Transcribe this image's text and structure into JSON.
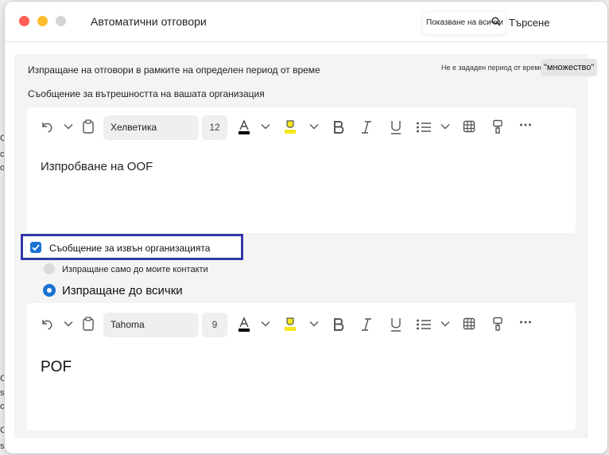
{
  "window": {
    "title": "Автоматични отговори"
  },
  "header": {
    "show_all": "Показване на всички",
    "search_label": "Търсене"
  },
  "schedule": {
    "range_label": "Изпращане на отговори в рамките на определен период от време",
    "not_set_label": "Не е зададен период от време",
    "multi_button": "\"множество\""
  },
  "inside": {
    "label": "Съобщение за вътрешността на вашата организация",
    "toolbar": {
      "font": "Хелветика",
      "size": "12"
    },
    "body": "Изпробване на OOF"
  },
  "outside": {
    "checkbox_label": "Съобщение за извън организацията",
    "checked": true,
    "options": [
      {
        "label": "Изпращане само до моите контакти",
        "selected": false
      },
      {
        "label": "Изпращане до всички",
        "selected": true
      }
    ],
    "toolbar": {
      "font": "Tahoma",
      "size": "9"
    },
    "body": "POF"
  },
  "colors": {
    "accent": "#1a73d4",
    "focus_ring": "#3238a8",
    "highlight": "#f5e61b"
  }
}
